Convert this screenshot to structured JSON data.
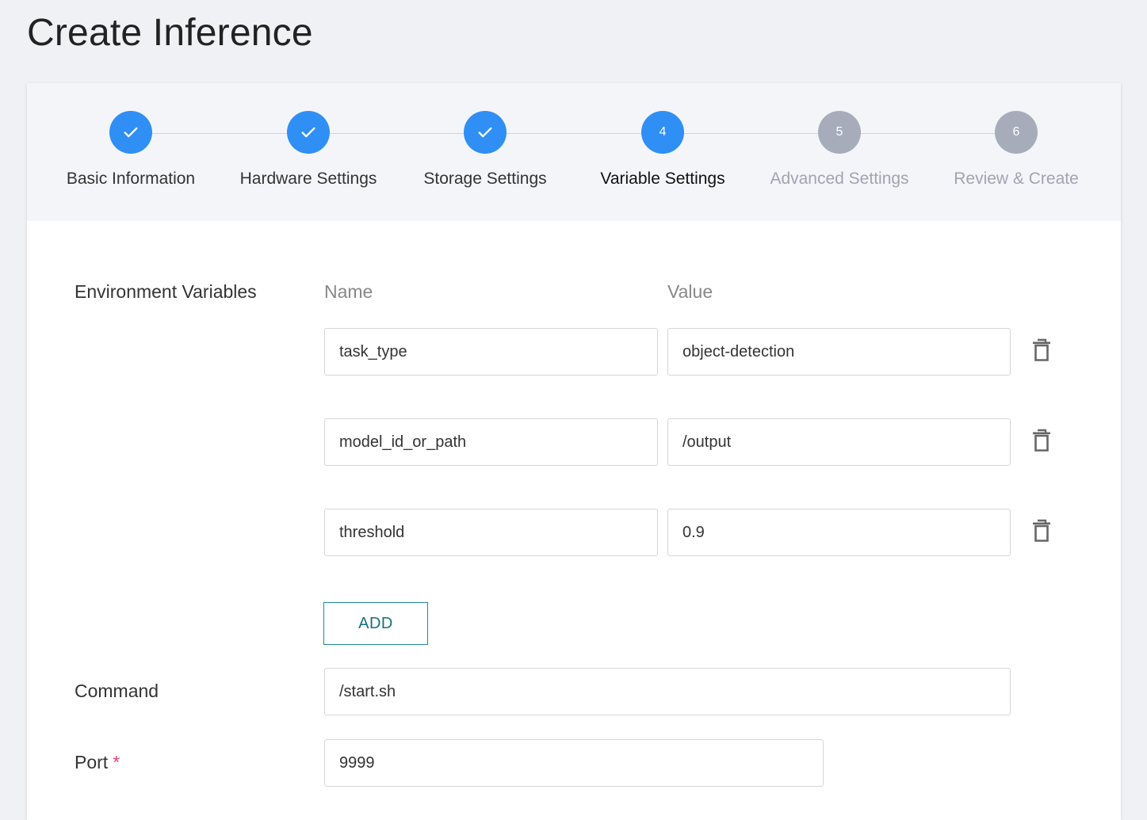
{
  "page": {
    "title": "Create Inference"
  },
  "stepper": {
    "steps": [
      {
        "number": "1",
        "label": "Basic Information",
        "state": "done",
        "icon": "check-icon"
      },
      {
        "number": "2",
        "label": "Hardware Settings",
        "state": "done",
        "icon": "check-icon"
      },
      {
        "number": "3",
        "label": "Storage Settings",
        "state": "done",
        "icon": "check-icon"
      },
      {
        "number": "4",
        "label": "Variable Settings",
        "state": "active"
      },
      {
        "number": "5",
        "label": "Advanced Settings",
        "state": "pending"
      },
      {
        "number": "6",
        "label": "Review & Create",
        "state": "pending"
      }
    ]
  },
  "form": {
    "env_label": "Environment Variables",
    "name_header": "Name",
    "value_header": "Value",
    "env_vars": [
      {
        "name": "task_type",
        "value": "object-detection"
      },
      {
        "name": "model_id_or_path",
        "value": "/output"
      },
      {
        "name": "threshold",
        "value": "0.9"
      }
    ],
    "delete_icon": "trash-icon",
    "add_label": "ADD",
    "command_label": "Command",
    "command_value": "/start.sh",
    "port_label": "Port",
    "port_required_mark": "*",
    "port_value": "9999"
  },
  "colors": {
    "accent": "#2f8ff5",
    "pending": "#a7acbb",
    "add_button": "#14707f",
    "required": "#e2477a"
  }
}
